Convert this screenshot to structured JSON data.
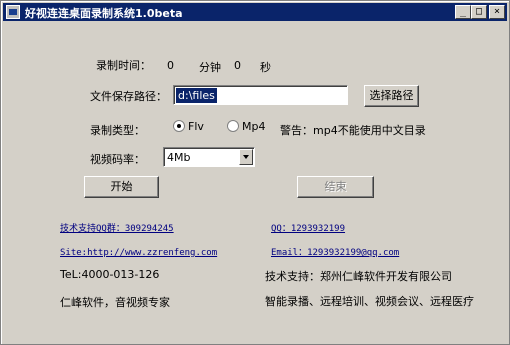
{
  "window": {
    "title": "好视连连桌面录制系统1.0beta"
  },
  "record_time": {
    "label": "录制时间：",
    "minutes": "0",
    "minutes_unit": "分钟",
    "seconds": "0",
    "seconds_unit": "秒"
  },
  "save_path": {
    "label": "文件保存路径：",
    "value": "d:\\files",
    "browse_button": "选择路径"
  },
  "record_type": {
    "label": "录制类型：",
    "option_flv": "Flv",
    "option_mp4": "Mp4",
    "selected": "Flv",
    "warning": "警告：mp4不能使用中文目录"
  },
  "bitrate": {
    "label": "视频码率：",
    "selected": "4Mb"
  },
  "controls": {
    "start_button": "开始",
    "stop_button": "结束"
  },
  "info": {
    "qq_group": "技术支持QQ群：309294245",
    "qq": "QQ：1293932199",
    "site": "Site:http://www.zzrenfeng.com",
    "email": "Email：1293932199@qq.com",
    "tel": "TeL:4000-013-126",
    "support": "技术支持：郑州仁峰软件开发有限公司",
    "slogan": "仁峰软件，音视频专家",
    "features": "智能录播、远程培训、视频会议、远程医疗"
  }
}
